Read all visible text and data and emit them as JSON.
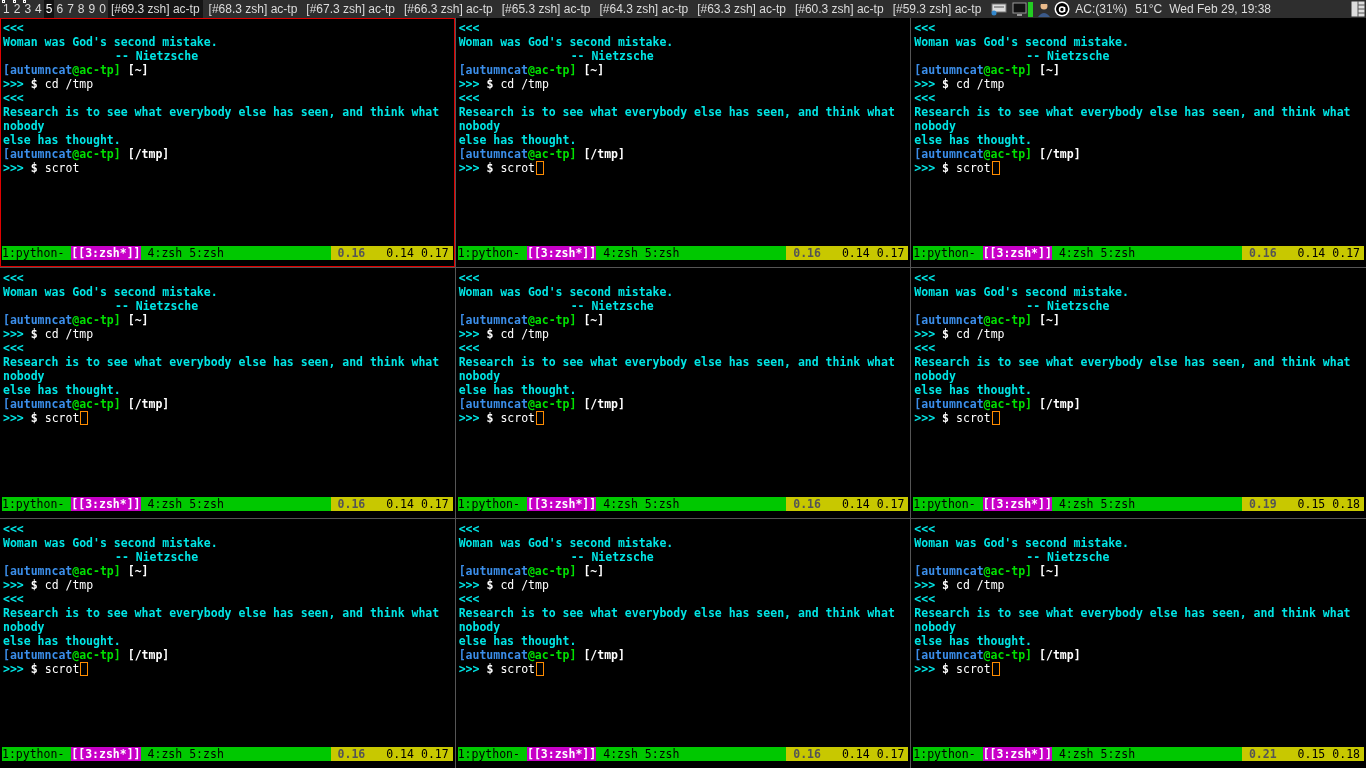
{
  "top_bar": {
    "workspaces": [
      {
        "label": "1",
        "selected": false,
        "occupied": true
      },
      {
        "label": "2",
        "selected": false,
        "occupied": true
      },
      {
        "label": "3",
        "selected": false,
        "occupied": true
      },
      {
        "label": "4",
        "selected": false,
        "occupied": false
      },
      {
        "label": "5",
        "selected": true,
        "occupied": false
      },
      {
        "label": "6",
        "selected": false,
        "occupied": false
      },
      {
        "label": "7",
        "selected": false,
        "occupied": false
      },
      {
        "label": "8",
        "selected": false,
        "occupied": false
      },
      {
        "label": "9",
        "selected": false,
        "occupied": false
      },
      {
        "label": "0",
        "selected": false,
        "occupied": false
      }
    ],
    "windows": [
      {
        "label": "[#69.3 zsh] ac-tp",
        "selected": true
      },
      {
        "label": "[#68.3 zsh] ac-tp",
        "selected": false
      },
      {
        "label": "[#67.3 zsh] ac-tp",
        "selected": false
      },
      {
        "label": "[#66.3 zsh] ac-tp",
        "selected": false
      },
      {
        "label": "[#65.3 zsh] ac-tp",
        "selected": false
      },
      {
        "label": "[#64.3 zsh] ac-tp",
        "selected": false
      },
      {
        "label": "[#63.3 zsh] ac-tp",
        "selected": false
      },
      {
        "label": "[#60.3 zsh] ac-tp",
        "selected": false
      },
      {
        "label": "[#59.3 zsh] ac-tp",
        "selected": false
      }
    ],
    "battery": "AC:(31%)",
    "temperature": "51°C",
    "clock": "Wed Feb 29, 19:38"
  },
  "panes": [
    {
      "focused": true,
      "cursor": false,
      "lines": [
        {
          "kind": "marker",
          "text": "<<<"
        },
        {
          "kind": "quote",
          "text": "Woman was God's second mistake."
        },
        {
          "kind": "attribution",
          "text": "-- Nietzsche"
        },
        {
          "kind": "prompt",
          "user": "[autumncat",
          "host": "@ac-tp]",
          "dir": "[~]"
        },
        {
          "kind": "command",
          "marker": ">>>",
          "sign": "$",
          "text": "cd /tmp"
        },
        {
          "kind": "marker",
          "text": "<<<"
        },
        {
          "kind": "quote",
          "text": "Research is to see what everybody else has seen, and think what"
        },
        {
          "kind": "quote",
          "text": "nobody"
        },
        {
          "kind": "quote",
          "text": "else has thought."
        },
        {
          "kind": "prompt",
          "user": "[autumncat",
          "host": "@ac-tp]",
          "dir": "[/tmp]"
        },
        {
          "kind": "command",
          "marker": ">>>",
          "sign": "$",
          "text": "scrot"
        }
      ],
      "tmux_windows": [
        {
          "label": "1:python-",
          "selected": false
        },
        {
          "label": "[[3:zsh*]]",
          "selected": true
        },
        {
          "label": "4:zsh",
          "selected": false
        },
        {
          "label": "5:zsh",
          "selected": false
        }
      ],
      "loads": [
        "0.16",
        "0.14",
        "0.17"
      ]
    },
    {
      "focused": false,
      "cursor": true,
      "lines": [
        {
          "kind": "marker",
          "text": "<<<"
        },
        {
          "kind": "quote",
          "text": "Woman was God's second mistake."
        },
        {
          "kind": "attribution",
          "text": "-- Nietzsche"
        },
        {
          "kind": "prompt",
          "user": "[autumncat",
          "host": "@ac-tp]",
          "dir": "[~]"
        },
        {
          "kind": "command",
          "marker": ">>>",
          "sign": "$",
          "text": "cd /tmp"
        },
        {
          "kind": "marker",
          "text": "<<<"
        },
        {
          "kind": "quote",
          "text": "Research is to see what everybody else has seen, and think what"
        },
        {
          "kind": "quote",
          "text": "nobody"
        },
        {
          "kind": "quote",
          "text": "else has thought."
        },
        {
          "kind": "prompt",
          "user": "[autumncat",
          "host": "@ac-tp]",
          "dir": "[/tmp]"
        },
        {
          "kind": "command",
          "marker": ">>>",
          "sign": "$",
          "text": "scrot"
        }
      ],
      "tmux_windows": [
        {
          "label": "1:python-",
          "selected": false
        },
        {
          "label": "[[3:zsh*]]",
          "selected": true
        },
        {
          "label": "4:zsh",
          "selected": false
        },
        {
          "label": "5:zsh",
          "selected": false
        }
      ],
      "loads": [
        "0.16",
        "0.14",
        "0.17"
      ]
    },
    {
      "focused": false,
      "cursor": true,
      "lines": [
        {
          "kind": "marker",
          "text": "<<<"
        },
        {
          "kind": "quote",
          "text": "Woman was God's second mistake."
        },
        {
          "kind": "attribution",
          "text": "-- Nietzsche"
        },
        {
          "kind": "prompt",
          "user": "[autumncat",
          "host": "@ac-tp]",
          "dir": "[~]"
        },
        {
          "kind": "command",
          "marker": ">>>",
          "sign": "$",
          "text": "cd /tmp"
        },
        {
          "kind": "marker",
          "text": "<<<"
        },
        {
          "kind": "quote",
          "text": "Research is to see what everybody else has seen, and think what"
        },
        {
          "kind": "quote",
          "text": "nobody"
        },
        {
          "kind": "quote",
          "text": "else has thought."
        },
        {
          "kind": "prompt",
          "user": "[autumncat",
          "host": "@ac-tp]",
          "dir": "[/tmp]"
        },
        {
          "kind": "command",
          "marker": ">>>",
          "sign": "$",
          "text": "scrot"
        }
      ],
      "tmux_windows": [
        {
          "label": "1:python-",
          "selected": false
        },
        {
          "label": "[[3:zsh*]]",
          "selected": true
        },
        {
          "label": "4:zsh",
          "selected": false
        },
        {
          "label": "5:zsh",
          "selected": false
        }
      ],
      "loads": [
        "0.16",
        "0.14",
        "0.17"
      ]
    },
    {
      "focused": false,
      "cursor": true,
      "lines": [
        {
          "kind": "marker",
          "text": "<<<"
        },
        {
          "kind": "quote",
          "text": "Woman was God's second mistake."
        },
        {
          "kind": "attribution",
          "text": "-- Nietzsche"
        },
        {
          "kind": "prompt",
          "user": "[autumncat",
          "host": "@ac-tp]",
          "dir": "[~]"
        },
        {
          "kind": "command",
          "marker": ">>>",
          "sign": "$",
          "text": "cd /tmp"
        },
        {
          "kind": "marker",
          "text": "<<<"
        },
        {
          "kind": "quote",
          "text": "Research is to see what everybody else has seen, and think what"
        },
        {
          "kind": "quote",
          "text": "nobody"
        },
        {
          "kind": "quote",
          "text": "else has thought."
        },
        {
          "kind": "prompt",
          "user": "[autumncat",
          "host": "@ac-tp]",
          "dir": "[/tmp]"
        },
        {
          "kind": "command",
          "marker": ">>>",
          "sign": "$",
          "text": "scrot"
        }
      ],
      "tmux_windows": [
        {
          "label": "1:python-",
          "selected": false
        },
        {
          "label": "[[3:zsh*]]",
          "selected": true
        },
        {
          "label": "4:zsh",
          "selected": false
        },
        {
          "label": "5:zsh",
          "selected": false
        }
      ],
      "loads": [
        "0.16",
        "0.14",
        "0.17"
      ]
    },
    {
      "focused": false,
      "cursor": true,
      "lines": [
        {
          "kind": "marker",
          "text": "<<<"
        },
        {
          "kind": "quote",
          "text": "Woman was God's second mistake."
        },
        {
          "kind": "attribution",
          "text": "-- Nietzsche"
        },
        {
          "kind": "prompt",
          "user": "[autumncat",
          "host": "@ac-tp]",
          "dir": "[~]"
        },
        {
          "kind": "command",
          "marker": ">>>",
          "sign": "$",
          "text": "cd /tmp"
        },
        {
          "kind": "marker",
          "text": "<<<"
        },
        {
          "kind": "quote",
          "text": "Research is to see what everybody else has seen, and think what"
        },
        {
          "kind": "quote",
          "text": "nobody"
        },
        {
          "kind": "quote",
          "text": "else has thought."
        },
        {
          "kind": "prompt",
          "user": "[autumncat",
          "host": "@ac-tp]",
          "dir": "[/tmp]"
        },
        {
          "kind": "command",
          "marker": ">>>",
          "sign": "$",
          "text": "scrot"
        }
      ],
      "tmux_windows": [
        {
          "label": "1:python-",
          "selected": false
        },
        {
          "label": "[[3:zsh*]]",
          "selected": true
        },
        {
          "label": "4:zsh",
          "selected": false
        },
        {
          "label": "5:zsh",
          "selected": false
        }
      ],
      "loads": [
        "0.16",
        "0.14",
        "0.17"
      ]
    },
    {
      "focused": false,
      "cursor": true,
      "lines": [
        {
          "kind": "marker",
          "text": "<<<"
        },
        {
          "kind": "quote",
          "text": "Woman was God's second mistake."
        },
        {
          "kind": "attribution",
          "text": "-- Nietzsche"
        },
        {
          "kind": "prompt",
          "user": "[autumncat",
          "host": "@ac-tp]",
          "dir": "[~]"
        },
        {
          "kind": "command",
          "marker": ">>>",
          "sign": "$",
          "text": "cd /tmp"
        },
        {
          "kind": "marker",
          "text": "<<<"
        },
        {
          "kind": "quote",
          "text": "Research is to see what everybody else has seen, and think what"
        },
        {
          "kind": "quote",
          "text": "nobody"
        },
        {
          "kind": "quote",
          "text": "else has thought."
        },
        {
          "kind": "prompt",
          "user": "[autumncat",
          "host": "@ac-tp]",
          "dir": "[/tmp]"
        },
        {
          "kind": "command",
          "marker": ">>>",
          "sign": "$",
          "text": "scrot"
        }
      ],
      "tmux_windows": [
        {
          "label": "1:python-",
          "selected": false
        },
        {
          "label": "[[3:zsh*]]",
          "selected": true
        },
        {
          "label": "4:zsh",
          "selected": false
        },
        {
          "label": "5:zsh",
          "selected": false
        }
      ],
      "loads": [
        "0.19",
        "0.15",
        "0.18"
      ]
    },
    {
      "focused": false,
      "cursor": true,
      "lines": [
        {
          "kind": "marker",
          "text": "<<<"
        },
        {
          "kind": "quote",
          "text": "Woman was God's second mistake."
        },
        {
          "kind": "attribution",
          "text": "-- Nietzsche"
        },
        {
          "kind": "prompt",
          "user": "[autumncat",
          "host": "@ac-tp]",
          "dir": "[~]"
        },
        {
          "kind": "command",
          "marker": ">>>",
          "sign": "$",
          "text": "cd /tmp"
        },
        {
          "kind": "marker",
          "text": "<<<"
        },
        {
          "kind": "quote",
          "text": "Research is to see what everybody else has seen, and think what"
        },
        {
          "kind": "quote",
          "text": "nobody"
        },
        {
          "kind": "quote",
          "text": "else has thought."
        },
        {
          "kind": "prompt",
          "user": "[autumncat",
          "host": "@ac-tp]",
          "dir": "[/tmp]"
        },
        {
          "kind": "command",
          "marker": ">>>",
          "sign": "$",
          "text": "scrot"
        }
      ],
      "tmux_windows": [
        {
          "label": "1:python-",
          "selected": false
        },
        {
          "label": "[[3:zsh*]]",
          "selected": true
        },
        {
          "label": "4:zsh",
          "selected": false
        },
        {
          "label": "5:zsh",
          "selected": false
        }
      ],
      "loads": [
        "0.16",
        "0.14",
        "0.17"
      ]
    },
    {
      "focused": false,
      "cursor": true,
      "lines": [
        {
          "kind": "marker",
          "text": "<<<"
        },
        {
          "kind": "quote",
          "text": "Woman was God's second mistake."
        },
        {
          "kind": "attribution",
          "text": "-- Nietzsche"
        },
        {
          "kind": "prompt",
          "user": "[autumncat",
          "host": "@ac-tp]",
          "dir": "[~]"
        },
        {
          "kind": "command",
          "marker": ">>>",
          "sign": "$",
          "text": "cd /tmp"
        },
        {
          "kind": "marker",
          "text": "<<<"
        },
        {
          "kind": "quote",
          "text": "Research is to see what everybody else has seen, and think what"
        },
        {
          "kind": "quote",
          "text": "nobody"
        },
        {
          "kind": "quote",
          "text": "else has thought."
        },
        {
          "kind": "prompt",
          "user": "[autumncat",
          "host": "@ac-tp]",
          "dir": "[/tmp]"
        },
        {
          "kind": "command",
          "marker": ">>>",
          "sign": "$",
          "text": "scrot"
        }
      ],
      "tmux_windows": [
        {
          "label": "1:python-",
          "selected": false
        },
        {
          "label": "[[3:zsh*]]",
          "selected": true
        },
        {
          "label": "4:zsh",
          "selected": false
        },
        {
          "label": "5:zsh",
          "selected": false
        }
      ],
      "loads": [
        "0.16",
        "0.14",
        "0.17"
      ]
    },
    {
      "focused": false,
      "cursor": true,
      "lines": [
        {
          "kind": "marker",
          "text": "<<<"
        },
        {
          "kind": "quote",
          "text": "Woman was God's second mistake."
        },
        {
          "kind": "attribution",
          "text": "-- Nietzsche"
        },
        {
          "kind": "prompt",
          "user": "[autumncat",
          "host": "@ac-tp]",
          "dir": "[~]"
        },
        {
          "kind": "command",
          "marker": ">>>",
          "sign": "$",
          "text": "cd /tmp"
        },
        {
          "kind": "marker",
          "text": "<<<"
        },
        {
          "kind": "quote",
          "text": "Research is to see what everybody else has seen, and think what"
        },
        {
          "kind": "quote",
          "text": "nobody"
        },
        {
          "kind": "quote",
          "text": "else has thought."
        },
        {
          "kind": "prompt",
          "user": "[autumncat",
          "host": "@ac-tp]",
          "dir": "[/tmp]"
        },
        {
          "kind": "command",
          "marker": ">>>",
          "sign": "$",
          "text": "scrot"
        }
      ],
      "tmux_windows": [
        {
          "label": "1:python-",
          "selected": false
        },
        {
          "label": "[[3:zsh*]]",
          "selected": true
        },
        {
          "label": "4:zsh",
          "selected": false
        },
        {
          "label": "5:zsh",
          "selected": false
        }
      ],
      "loads": [
        "0.21",
        "0.15",
        "0.18"
      ]
    }
  ]
}
